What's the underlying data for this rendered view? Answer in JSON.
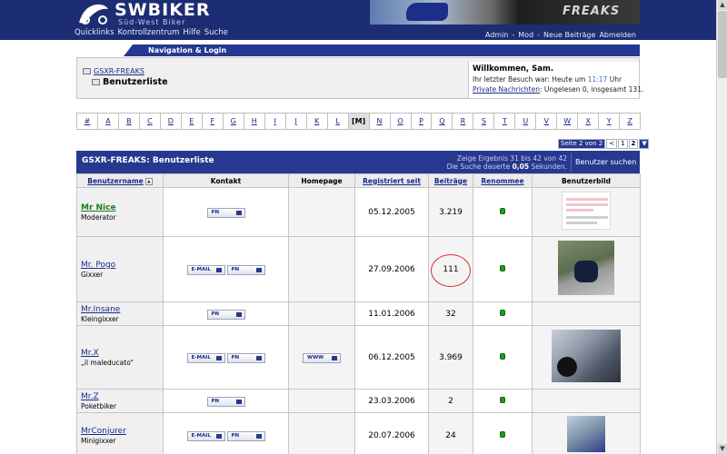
{
  "header": {
    "logo_main": "SWBIKER",
    "logo_sub": "Süd-West Biker",
    "quicklinks": [
      "Quicklinks",
      "Kontrollzentrum",
      "Hilfe",
      "Suche"
    ],
    "banner_text": "FREAKS",
    "userlinks": [
      "Admin",
      "-",
      "Mod",
      "-",
      "Neue Beiträge",
      "Abmelden"
    ]
  },
  "nav": {
    "title": "Navigation & Login",
    "breadcrumb_parent": "GSXR-FREAKS",
    "breadcrumb_current": "Benutzerliste",
    "welcome_title": "Willkommen, Sam.",
    "last_visit_prefix": "Ihr letzter Besuch war: Heute um",
    "last_visit_time": "11:17",
    "last_visit_suffix": "Uhr",
    "pm_link": "Private Nachrichten",
    "pm_status": ": Ungelesen 0, insgesamt 131."
  },
  "alphabet": [
    "#",
    "A",
    "B",
    "C",
    "D",
    "E",
    "F",
    "G",
    "H",
    "I",
    "J",
    "K",
    "L",
    "[M]",
    "N",
    "O",
    "P",
    "Q",
    "R",
    "S",
    "T",
    "U",
    "V",
    "W",
    "X",
    "Y",
    "Z"
  ],
  "alphabet_active": "[M]",
  "pager": {
    "label": "Seite 2 von 2",
    "prev": "<",
    "pages": [
      "1",
      "2"
    ],
    "current": "2"
  },
  "list": {
    "title": "GSXR-FREAKS: Benutzerliste",
    "result_line": "Zeige Ergebnis 31 bis 42 von 42",
    "duration_prefix": "Die Suche dauerte",
    "duration_value": "0,05",
    "duration_suffix": "Sekunden.",
    "search_button": "Benutzer suchen"
  },
  "columns": {
    "username": "Benutzername",
    "contact": "Kontakt",
    "homepage": "Homepage",
    "registered": "Registriert seit",
    "posts": "Beiträge",
    "reputation": "Renommee",
    "picture": "Benutzerbild"
  },
  "buttons": {
    "pm": "PN",
    "email": "E-MAIL",
    "www": "WWW"
  },
  "members": [
    {
      "name": "Mr Nice",
      "title": "Moderator",
      "registered": "05.12.2005",
      "posts": "3.219"
    },
    {
      "name": "Mr. Pogo",
      "title": "Gixxer",
      "registered": "27.09.2006",
      "posts": "111"
    },
    {
      "name": "Mr.Insane",
      "title": "Kleingixxer",
      "registered": "11.01.2006",
      "posts": "32"
    },
    {
      "name": "Mr.X",
      "title": "„il maleducato“",
      "registered": "06.12.2005",
      "posts": "3.969"
    },
    {
      "name": "Mr.Z",
      "title": "Poketbiker",
      "registered": "23.03.2006",
      "posts": "2"
    },
    {
      "name": "MrConjurer",
      "title": "Minigixxer",
      "registered": "20.07.2006",
      "posts": "24"
    }
  ],
  "colors": {
    "header_bg": "#1c2d73",
    "accent_blue": "#26388f",
    "link": "#1a2a8a",
    "moderator": "#1c7a1c",
    "reputation": "#1f9a1f",
    "annotation_circle": "#d03030"
  }
}
